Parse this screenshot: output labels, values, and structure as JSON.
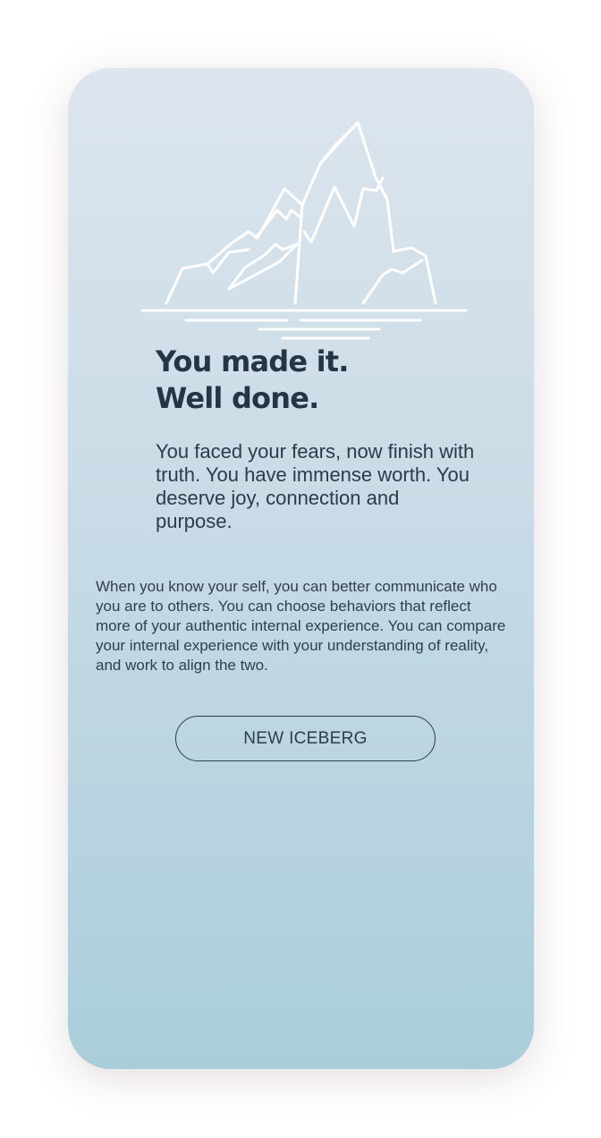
{
  "headline": {
    "line1": "You made it.",
    "line2": "Well done."
  },
  "lead": "You faced your fears, now finish with truth. You have immense worth. You deserve joy, connection and purpose.",
  "body": "When you know your self, you can better communicate who you are to others. You can choose behaviors that reflect more of your authentic internal experience. You can compare your internal experience with your understanding of reality, and work to align the two.",
  "button": {
    "label": "NEW ICEBERG"
  },
  "illustration": {
    "icon": "iceberg-icon",
    "stroke_color": "#ffffff"
  },
  "colors": {
    "gradient_top": "#dde5ee",
    "gradient_bottom": "#aacdda",
    "text_dark": "#243645"
  }
}
